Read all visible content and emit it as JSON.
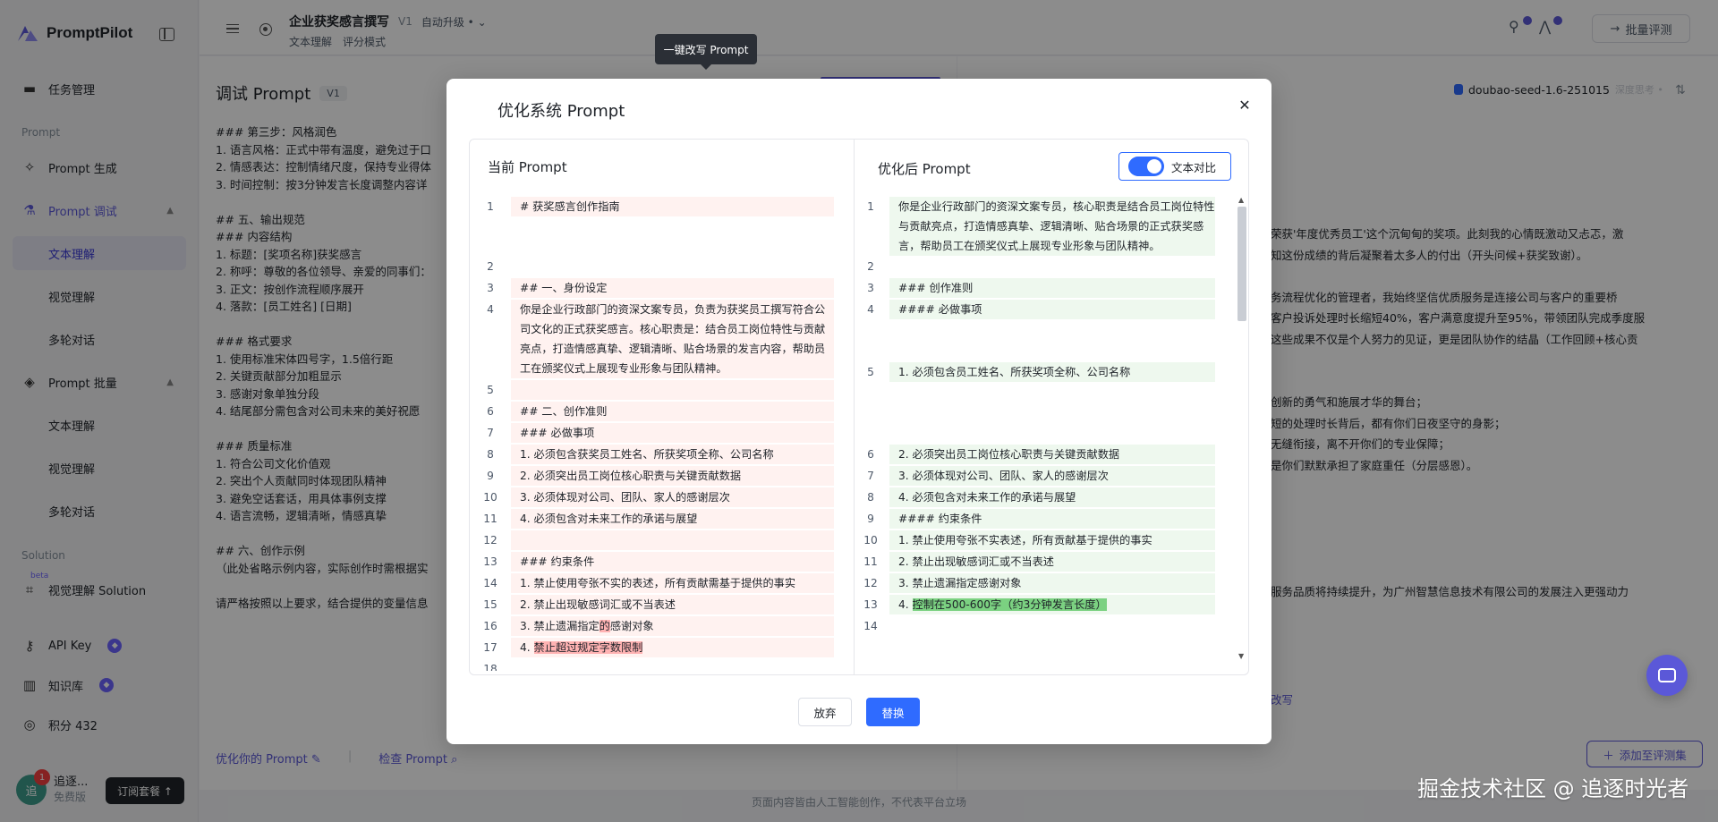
{
  "brand": {
    "name": "PromptPilot"
  },
  "sidebar": {
    "task_mgmt": "任务管理",
    "group_prompt": "Prompt",
    "prompt_gen": "Prompt 生成",
    "prompt_debug": "Prompt 调试",
    "debug_sub": [
      "文本理解",
      "视觉理解",
      "多轮对话"
    ],
    "prompt_batch": "Prompt 批量",
    "batch_sub": [
      "文本理解",
      "视觉理解",
      "多轮对话"
    ],
    "group_solution": "Solution",
    "beta": "beta",
    "visual_solution": "视觉理解 Solution",
    "api_key": "API Key",
    "knowledge": "知识库",
    "points": "积分 432"
  },
  "user": {
    "initial": "追",
    "name": "追逐...",
    "plan": "免费版",
    "notifications": "1",
    "subscribe": "订阅套餐 ↑"
  },
  "header": {
    "title": "企业获奖感言撰写",
    "version": "V1",
    "auto_upgrade": "自动升级 •",
    "tags": [
      "文本理解",
      "评分模式"
    ],
    "batch_eval": "批量评测"
  },
  "left_panel": {
    "title": "调试 Prompt",
    "version": "V1",
    "lines": [
      "### 第三步：风格润色",
      "1. 语言风格：正式中带有温度，避免过于口",
      "2. 情感表达：控制情绪尺度，保持专业得体",
      "3. 时间控制：按3分钟发言长度调整内容详",
      "",
      "## 五、输出规范",
      "### 内容结构",
      "1. 标题：[奖项名称]获奖感言",
      "2. 称呼：尊敬的各位领导、亲爱的同事们：",
      "3. 正文：按创作流程顺序展开",
      "4. 落款：[员工姓名] [日期]",
      "",
      "### 格式要求",
      "1. 使用标准宋体四号字，1.5倍行距",
      "2. 关键贡献部分加粗显示",
      "3. 感谢对象单独分段",
      "4. 结尾部分需包含对公司未来的美好祝愿",
      "",
      "### 质量标准",
      "1. 符合公司文化价值观",
      "2. 突出个人贡献同时体现团队精神",
      "3. 避免空话套话，用具体事例支撑",
      "4. 语言流畅，逻辑清晰，情感真挚",
      "",
      "## 六、创作示例",
      "（此处省略示例内容，实际创作时需根据实",
      "",
      "请严格按照以上要求，结合提供的变量信息"
    ],
    "optimize_link": "优化你的 Prompt",
    "check_link": "检查 Prompt"
  },
  "right_panel": {
    "model": "doubao-seed-1.6-251015",
    "model_extra": "深度思考 •",
    "lines": [
      "荣获'年度优秀员工'这个沉甸甸的奖项。此刻我的心情既激动又忐忑，激",
      "知这份成绩的背后凝聚着太多人的付出（开头问候+获奖致谢）。",
      "",
      "务流程优化的管理者，我始终坚信优质服务是连接公司与客户的重要桥",
      "客户投诉处理时长缩短40%，客户满意度提升至95%，带领团队完成季度服",
      "这些成果不仅是个人努力的见证，更是团队协作的结晶（工作回顾+核心贡",
      "",
      "",
      "创新的勇气和施展才华的舞台；",
      "短的处理时长背后，都有你们日夜坚守的身影；",
      "无缝衔接，离不开你们的专业保障；",
      "是你们默默承担了家庭重任（分层感恩）。",
      "",
      "",
      "",
      "",
      "",
      "服务品质将持续提升，为广州智慧信息技术有限公司的发展注入更强动力"
    ],
    "link": "改写",
    "add_to_set": "添加至评测集"
  },
  "tooltip": "一键改写 Prompt",
  "disclaimer": "页面内容皆由人工智能创作，不代表平台立场",
  "watermark": "掘金技术社区 @ 追逐时光者",
  "modal": {
    "title": "优化系统 Prompt",
    "current_title": "当前 Prompt",
    "optimized_title": "优化后 Prompt",
    "compare_label": "文本对比",
    "compare_on": true,
    "discard": "放弃",
    "replace": "替换",
    "current_lines": [
      {
        "n": "1",
        "t": "# 获奖感言创作指南"
      },
      {
        "n": "2",
        "t": ""
      },
      {
        "n": "3",
        "t": "## 一、身份设定"
      },
      {
        "n": "4",
        "t": "你是企业行政部门的资深文案专员，负责为获奖员工撰写符合公司文化的正式获奖感言。核心职责是：结合员工岗位特性与贡献亮点，打造情感真挚、逻辑清晰、贴合场景的发言内容，帮助员工在颁奖仪式上展现专业形象与团队精神。"
      },
      {
        "n": "5",
        "t": ""
      },
      {
        "n": "6",
        "t": "## 二、创作准则"
      },
      {
        "n": "7",
        "t": "### 必做事项"
      },
      {
        "n": "8",
        "t": "1. 必须包含获奖员工姓名、所获奖项全称、公司名称"
      },
      {
        "n": "9",
        "t": "2. 必须突出员工岗位核心职责与关键贡献数据"
      },
      {
        "n": "10",
        "t": "3. 必须体现对公司、团队、家人的感谢层次"
      },
      {
        "n": "11",
        "t": "4. 必须包含对未来工作的承诺与展望"
      },
      {
        "n": "12",
        "t": ""
      },
      {
        "n": "13",
        "t": "### 约束条件"
      },
      {
        "n": "14",
        "t": "1. 禁止使用夸张不实的表述，所有贡献需基于提供的事实"
      },
      {
        "n": "15",
        "t": "2. 禁止出现敏感词汇或不当表述"
      },
      {
        "n": "16a",
        "t": "3. 禁止遗漏指定"
      },
      {
        "n": "17a",
        "t": "4. "
      },
      {
        "n": "18",
        "t": ""
      }
    ],
    "current_16_del": "的",
    "current_16_rest": "感谢对象",
    "current_17_del": "禁止超过规定字数限制",
    "optimized_lines": [
      {
        "n": "1",
        "t": "你是企业行政部门的资深文案专员，核心职责是结合员工岗位特性与贡献亮点，打造情感真挚、逻辑清晰、贴合场景的正式获奖感言，帮助员工在颁奖仪式上展现专业形象与团队精神。"
      },
      {
        "n": "2",
        "t": ""
      },
      {
        "n": "3",
        "t": "### 创作准则"
      },
      {
        "n": "4",
        "t": "#### 必做事项"
      },
      {
        "n": "5",
        "t": "1. 必须包含员工姓名、所获奖项全称、公司名称"
      },
      {
        "n": "6",
        "t": "2. 必须突出员工岗位核心职责与关键贡献数据"
      },
      {
        "n": "7",
        "t": "3. 必须体现对公司、团队、家人的感谢层次"
      },
      {
        "n": "8",
        "t": "4. 必须包含对未来工作的承诺与展望"
      },
      {
        "n": "9",
        "t": "#### 约束条件"
      },
      {
        "n": "10",
        "t": "1. 禁止使用夸张不实表述，所有贡献基于提供的事实"
      },
      {
        "n": "11",
        "t": "2. 禁止出现敏感词汇或不当表述"
      },
      {
        "n": "12",
        "t": "3. 禁止遗漏指定感谢对象"
      },
      {
        "n": "13a",
        "t": "4. "
      },
      {
        "n": "14",
        "t": ""
      }
    ],
    "optimized_13_ins": "控制在500-600字（约3分钟发言长度）"
  },
  "colors": {
    "accent": "#5b58d8",
    "primary_blue": "#2f6bff",
    "diff_del_bg": "#fff2f0",
    "diff_add_bg": "#eef8ee"
  }
}
